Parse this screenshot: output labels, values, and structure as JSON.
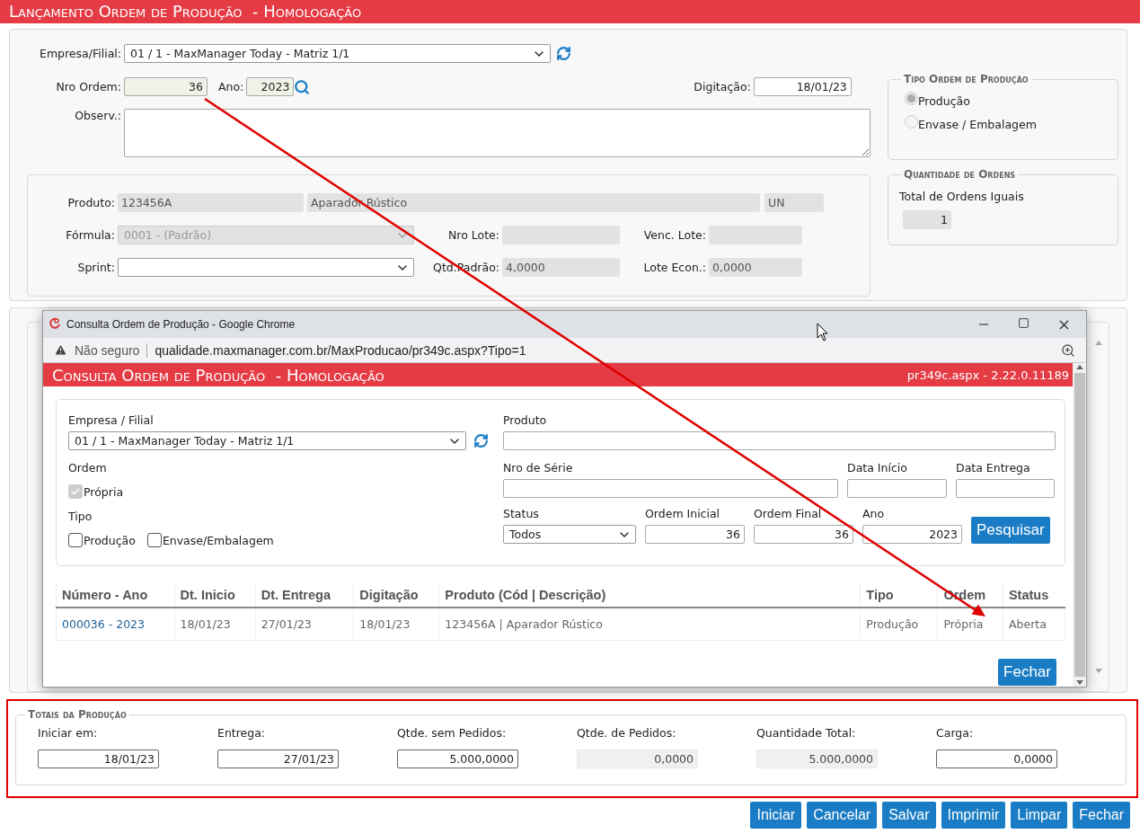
{
  "page_title": "Lançamento Ordem de Produção  - Homologação",
  "form": {
    "empresa": {
      "label": "Empresa/Filial:",
      "value": "01 / 1 - MaxManager Today - Matriz 1/1"
    },
    "nro_ordem": {
      "label": "Nro Ordem:",
      "value": "36"
    },
    "ano": {
      "label": "Ano:",
      "value": "2023"
    },
    "digitacao": {
      "label": "Digitação:",
      "value": "18/01/23"
    },
    "observ": {
      "label": "Observ.:"
    }
  },
  "produto_panel": {
    "produto": {
      "label": "Produto:",
      "code": "123456A",
      "description": "Aparador Rústico",
      "unit": "UN"
    },
    "formula": {
      "label": "Fórmula:",
      "value": "0001 - (Padrão)",
      "disabled": true
    },
    "sprint": {
      "label": "Sprint:"
    },
    "nro_lote": {
      "label": "Nro Lote:"
    },
    "venc_lote": {
      "label": "Venc. Lote:"
    },
    "qtd_padrao": {
      "label": "Qtd.Padrão:",
      "value": "4,0000"
    },
    "lote_econ": {
      "label": "Lote Econ.:",
      "value": "0,0000"
    }
  },
  "tipo_ordem": {
    "legend": "Tipo Ordem de Produção",
    "options": [
      {
        "label": "Produção",
        "selected": true
      },
      {
        "label": "Envase / Embalagem",
        "selected": false
      }
    ]
  },
  "quantidade": {
    "legend": "Quantidade de Ordens",
    "label": "Total de Ordens Iguais",
    "value": "1"
  },
  "popup": {
    "title": "Consulta Ordem de Produção - Google Chrome",
    "security": "Não seguro",
    "url": "qualidade.maxmanager.com.br/MaxProducao/pr349c.aspx?Tipo=1",
    "header": "Consulta Ordem de Produção  - Homologação",
    "version": "pr349c.aspx - 2.22.0.11189",
    "filters": {
      "empresa": {
        "label": "Empresa / Filial",
        "value": "01 / 1 - MaxManager Today - Matriz 1/1"
      },
      "ordem": {
        "label": "Ordem",
        "option": {
          "label": "Própria",
          "checked": true,
          "disabled": true
        }
      },
      "tipo": {
        "label": "Tipo",
        "options": [
          {
            "label": "Produção",
            "checked": false
          },
          {
            "label": "Envase/Embalagem",
            "checked": false
          }
        ]
      },
      "produto": {
        "label": "Produto"
      },
      "nro_serie": {
        "label": "Nro de Série"
      },
      "data_inicio": {
        "label": "Data Início"
      },
      "data_entrega": {
        "label": "Data Entrega"
      },
      "status": {
        "label": "Status",
        "value": "Todos"
      },
      "ordem_inicial": {
        "label": "Ordem Inicial",
        "value": "36"
      },
      "ordem_final": {
        "label": "Ordem Final",
        "value": "36"
      },
      "ano": {
        "label": "Ano",
        "value": "2023"
      },
      "search_button": "Pesquisar"
    },
    "table": {
      "columns": [
        "Número - Ano",
        "Dt. Inicio",
        "Dt. Entrega",
        "Digitação",
        "Produto (Cód | Descrição)",
        "Tipo",
        "Ordem",
        "Status"
      ],
      "rows": [
        {
          "cells": [
            "000036 - 2023",
            "18/01/23",
            "27/01/23",
            "18/01/23",
            "123456A | Aparador Rústico",
            "Produção",
            "Própria",
            "Aberta"
          ]
        }
      ]
    },
    "close_button": "Fechar"
  },
  "totais": {
    "legend": "Totais da Produção",
    "fields": [
      {
        "label": "Iniciar em:",
        "value": "18/01/23",
        "disabled": false
      },
      {
        "label": "Entrega:",
        "value": "27/01/23",
        "disabled": false
      },
      {
        "label": "Qtde. sem Pedidos:",
        "value": "5.000,0000",
        "disabled": false
      },
      {
        "label": "Qtde. de Pedidos:",
        "value": "0,0000",
        "disabled": true
      },
      {
        "label": "Quantidade Total:",
        "value": "5.000,0000",
        "disabled": true
      },
      {
        "label": "Carga:",
        "value": "0,0000",
        "disabled": false
      }
    ]
  },
  "buttons": [
    "Iniciar",
    "Cancelar",
    "Salvar",
    "Imprimir",
    "Limpar",
    "Fechar"
  ]
}
